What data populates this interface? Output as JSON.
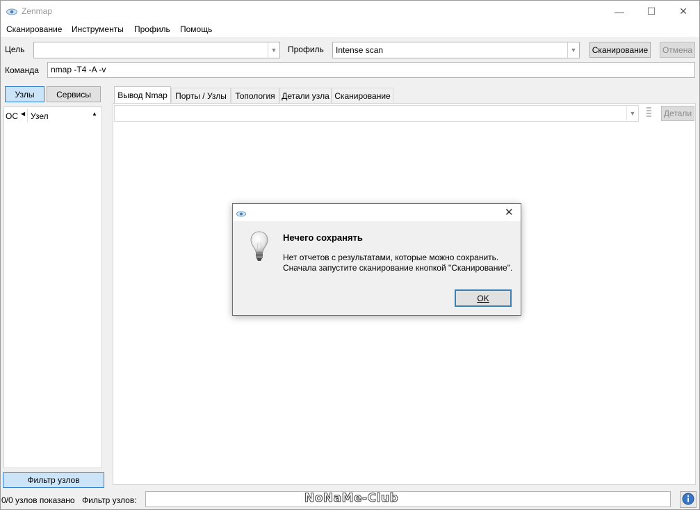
{
  "window": {
    "title": "Zenmap",
    "minimize": "—",
    "maximize": "☐",
    "close": "✕"
  },
  "menu": [
    "Сканирование",
    "Инструменты",
    "Профиль",
    "Помощь"
  ],
  "toolbar": {
    "target_label": "Цель",
    "target_value": "",
    "profile_label": "Профиль",
    "profile_value": "Intense scan",
    "scan_button": "Сканирование",
    "cancel_button": "Отмена",
    "command_label": "Команда",
    "command_value": "nmap -T4 -A -v"
  },
  "left_panel": {
    "hosts_button": "Узлы",
    "services_button": "Сервисы",
    "col_os": "ОС",
    "col_host": "Узел",
    "filter_button": "Фильтр узлов"
  },
  "tabs": [
    "Вывод Nmap",
    "Порты / Узлы",
    "Топология",
    "Детали узла",
    "Сканирование"
  ],
  "output": {
    "details_button": "Детали"
  },
  "status": {
    "shown": "0/0 узлов показано",
    "filter_label": "Фильтр узлов:",
    "filter_value": ""
  },
  "dialog": {
    "heading": "Нечего сохранять",
    "line1": "Нет отчетов с результатами, которые можно сохранить.",
    "line2": "Сначала запустите сканирование кнопкой \"Сканирование\".",
    "ok": "OK",
    "close": "✕"
  },
  "watermark": "NoNaMe-Club",
  "colors": {
    "accent": "#2c7ad3",
    "selected_button": "#cce4f7"
  }
}
